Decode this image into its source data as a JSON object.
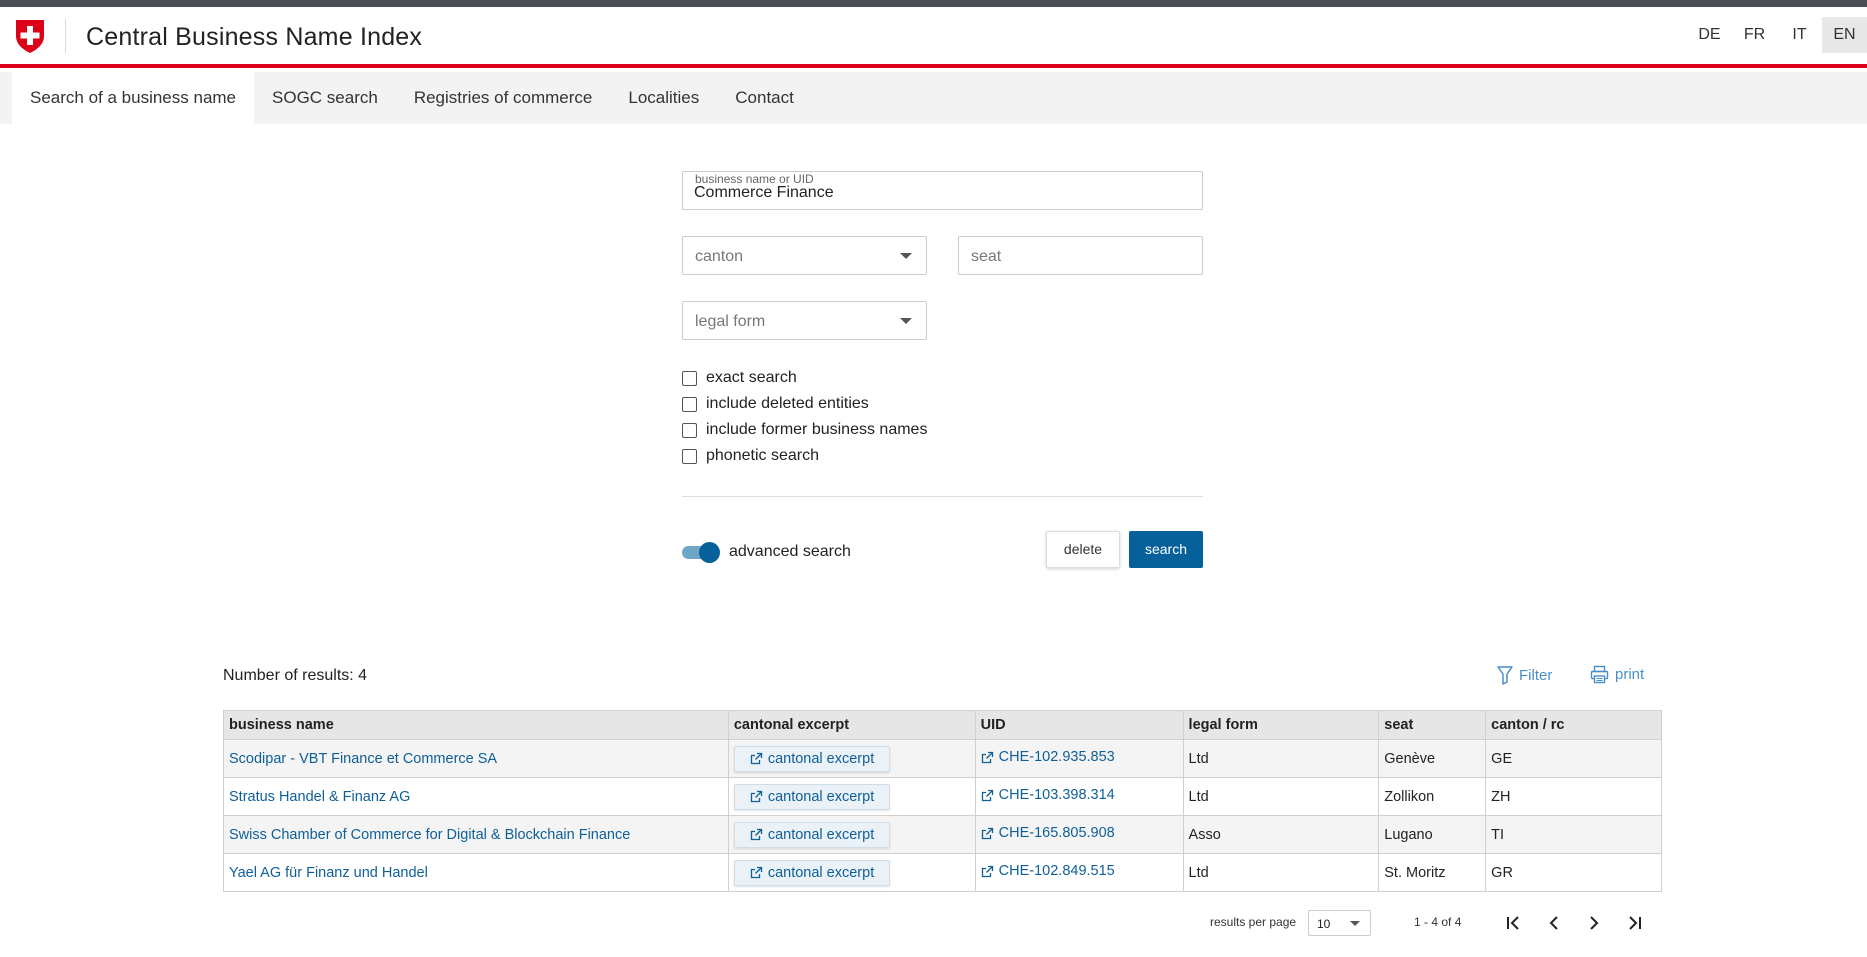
{
  "app": {
    "title": "Central Business Name Index",
    "accent_color": "#dc0018",
    "primary_color": "#06609a",
    "logo_icon": "swiss-cross-shield"
  },
  "languages": [
    {
      "label": "DE",
      "active": false
    },
    {
      "label": "FR",
      "active": false
    },
    {
      "label": "IT",
      "active": false
    },
    {
      "label": "EN",
      "active": true
    }
  ],
  "nav": {
    "items": [
      {
        "label": "Search of a business name",
        "active": true
      },
      {
        "label": "SOGC search",
        "active": false
      },
      {
        "label": "Registries of commerce",
        "active": false
      },
      {
        "label": "Localities",
        "active": false
      },
      {
        "label": "Contact",
        "active": false
      }
    ]
  },
  "search": {
    "name_label": "business name or UID",
    "name_value": "Commerce Finance",
    "canton_placeholder": "canton",
    "seat_placeholder": "seat",
    "legal_form_placeholder": "legal form",
    "options": [
      {
        "label": "exact search",
        "checked": false
      },
      {
        "label": "include deleted entities",
        "checked": false
      },
      {
        "label": "include former business names",
        "checked": false
      },
      {
        "label": "phonetic search",
        "checked": false
      }
    ],
    "advanced_label": "advanced search",
    "advanced_enabled": true,
    "delete_label": "delete",
    "search_label": "search"
  },
  "results": {
    "count_text": "Number of results: 4",
    "filter_label": "Filter",
    "print_label": "print",
    "filter_icon": "filter-icon",
    "print_icon": "printer-icon",
    "columns": [
      "business name",
      "cantonal excerpt",
      "UID",
      "legal form",
      "seat",
      "canton / rc"
    ],
    "rows": [
      {
        "name": "Scodipar - VBT Finance et Commerce SA",
        "excerpt": "cantonal excerpt",
        "uid": "CHE-102.935.853",
        "legal_form": "Ltd",
        "seat": "Genève",
        "canton": "GE"
      },
      {
        "name": "Stratus Handel & Finanz AG",
        "excerpt": "cantonal excerpt",
        "uid": "CHE-103.398.314",
        "legal_form": "Ltd",
        "seat": "Zollikon",
        "canton": "ZH"
      },
      {
        "name": "Swiss Chamber of Commerce for Digital & Blockchain Finance",
        "excerpt": "cantonal excerpt",
        "uid": "CHE-165.805.908",
        "legal_form": "Asso",
        "seat": "Lugano",
        "canton": "TI"
      },
      {
        "name": "Yael AG für Finanz und Handel",
        "excerpt": "cantonal excerpt",
        "uid": "CHE-102.849.515",
        "legal_form": "Ltd",
        "seat": "St. Moritz",
        "canton": "GR"
      }
    ]
  },
  "pagination": {
    "rpp_label": "results per page",
    "rpp_value": "10",
    "range_text": "1 - 4 of 4"
  }
}
